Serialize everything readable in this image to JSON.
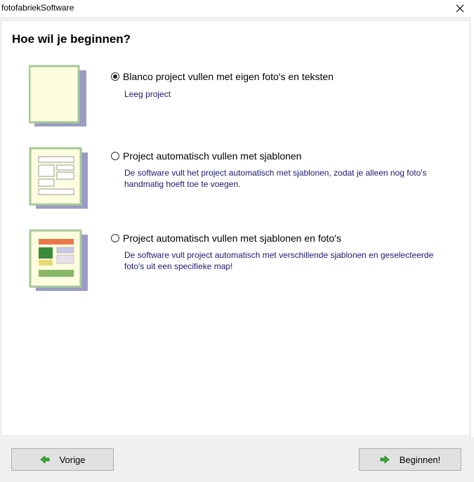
{
  "window": {
    "title": "fotofabriekSoftware",
    "close_icon": "close-icon"
  },
  "heading": "Hoe wil je beginnen?",
  "options": [
    {
      "label": "Blanco project vullen met eigen foto's en teksten",
      "description": "Leeg project",
      "selected": true,
      "icon": "blank-page-icon"
    },
    {
      "label": "Project automatisch vullen met sjablonen",
      "description": "De software vult het project automatisch met sjablonen, zodat je alleen nog foto's handmatig hoeft toe te voegen.",
      "selected": false,
      "icon": "template-page-icon"
    },
    {
      "label": "Project automatisch vullen met sjablonen en foto's",
      "description": "De software vult project automatisch met verschillende sjablonen en geselecteerde foto's uit een specifieke map!",
      "selected": false,
      "icon": "template-photos-page-icon"
    }
  ],
  "buttons": {
    "back": "Vorige",
    "start": "Beginnen!"
  },
  "colors": {
    "page_fill": "#fdfde0",
    "page_border": "#a6c898",
    "page_shadow": "#9b9bc4",
    "arrow": "#33aa33",
    "description_text": "#1a1a6e"
  }
}
